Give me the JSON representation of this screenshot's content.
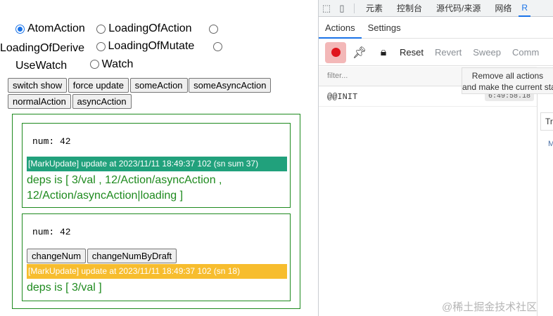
{
  "radios": [
    {
      "label": "AtomAction",
      "checked": true
    },
    {
      "label": "LoadingOfAction",
      "checked": false
    },
    {
      "label": "LoadingOfDerive",
      "checked": false
    },
    {
      "label": "LoadingOfMutate",
      "checked": false
    },
    {
      "label": "UseWatch",
      "checked": false
    },
    {
      "label": "Watch",
      "checked": false
    }
  ],
  "buttons": {
    "switch_show": "switch show",
    "force_update": "force update",
    "some_action": "someAction",
    "some_async_action": "someAsyncAction",
    "normal_action": "normalAction",
    "async_action": "asyncAction"
  },
  "box1": {
    "num": "num: 42",
    "mark": "[MarkUpdate] update at 2023/11/11 18:49:37 102 (sn sum 37)",
    "mark_color": "#21a17c",
    "deps": "deps is [ 3/val , 12/Action/asyncAction , 12/Action/asyncAction|loading ]"
  },
  "box2": {
    "num": "num: 42",
    "change_num": "changeNum",
    "change_num_by_draft": "changeNumByDraft",
    "mark": "[MarkUpdate] update at 2023/11/11 18:49:37 102 (sn 18)",
    "mark_color": "#f7bd2e",
    "deps": "deps is [ 3/val ]"
  },
  "devtools": {
    "tabs": [
      "元素",
      "控制台",
      "源代码/来源",
      "网络",
      "R"
    ],
    "active_tab": "R",
    "redux_tabs": [
      "Actions",
      "Settings"
    ],
    "toolbar": [
      "Reset",
      "Revert",
      "Sweep",
      "Comm"
    ],
    "filter_placeholder": "filter...",
    "tooltip_line1": "Remove all actions",
    "tooltip_line2": "and make the current sta",
    "actions": [
      {
        "name": "@@INIT",
        "time": "6:49:58.18"
      }
    ],
    "right_tab": "Tr",
    "right_m": "M"
  },
  "watermark": "@稀土掘金技术社区"
}
